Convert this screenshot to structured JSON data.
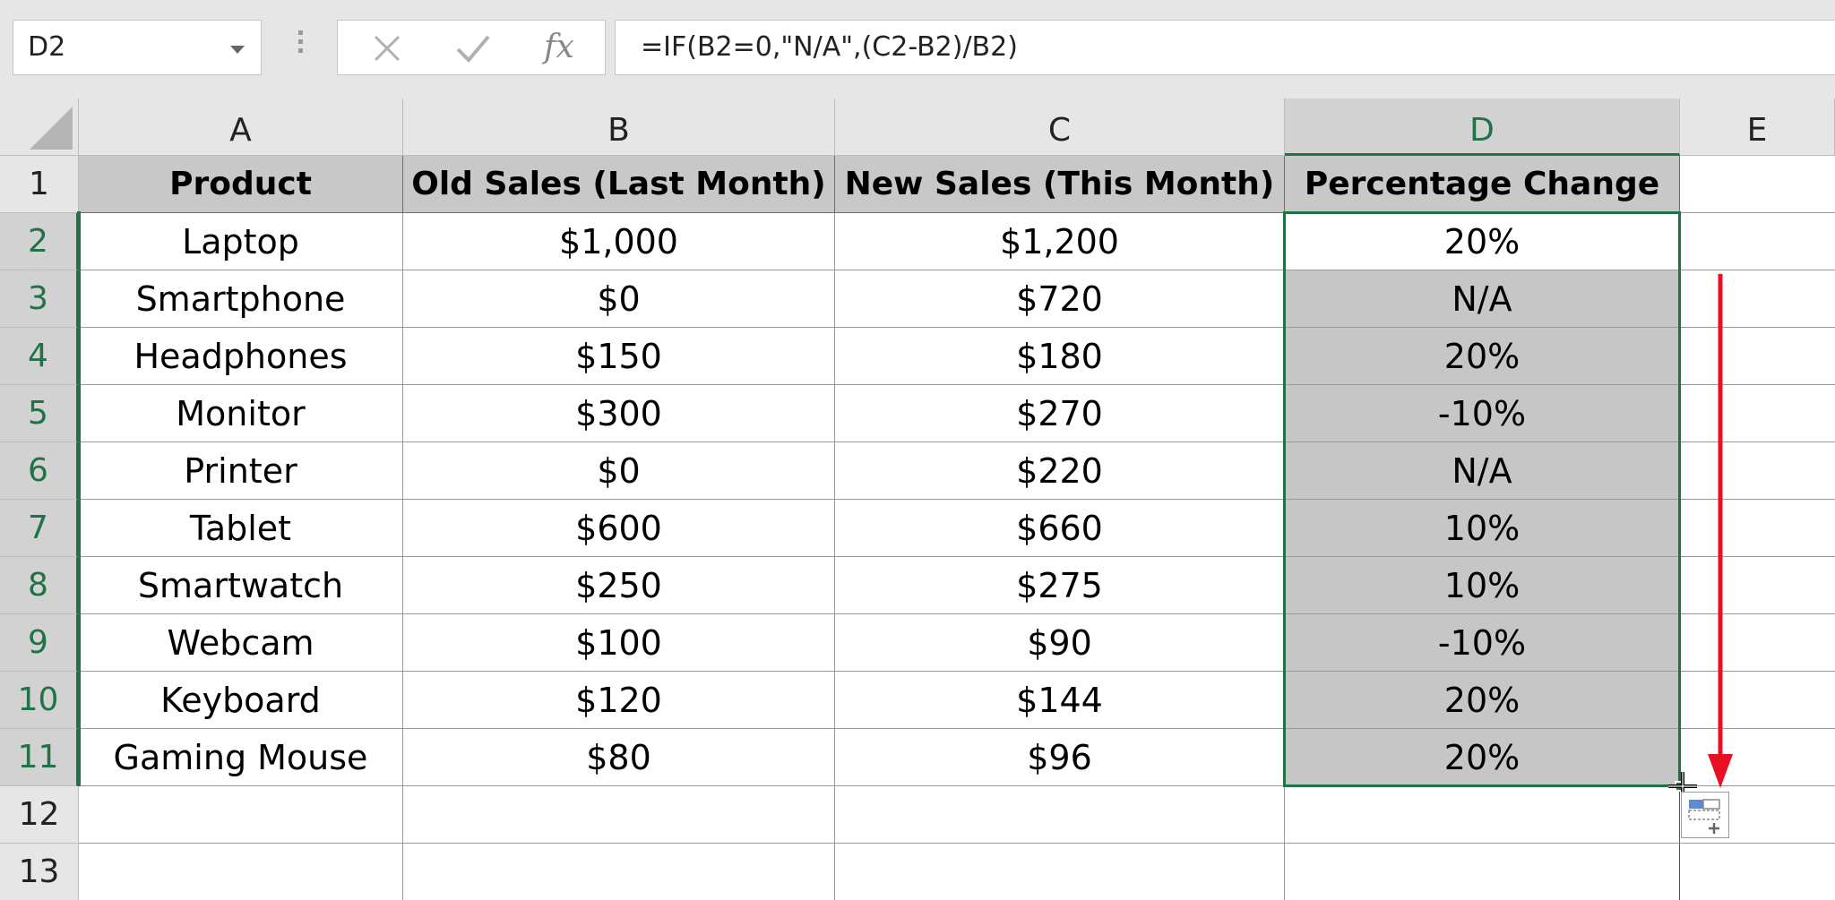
{
  "formula_bar": {
    "name_box": "D2",
    "formula": "=IF(B2=0,\"N/A\",(C2-B2)/B2)"
  },
  "columns": [
    "A",
    "B",
    "C",
    "D",
    "E"
  ],
  "rows": [
    "1",
    "2",
    "3",
    "4",
    "5",
    "6",
    "7",
    "8",
    "9",
    "10",
    "11",
    "12",
    "13"
  ],
  "table": {
    "headers": [
      "Product",
      "Old Sales (Last Month)",
      "New Sales (This Month)",
      "Percentage Change"
    ],
    "data": [
      [
        "Laptop",
        "$1,000",
        "$1,200",
        "20%"
      ],
      [
        "Smartphone",
        "$0",
        "$720",
        "N/A"
      ],
      [
        "Headphones",
        "$150",
        "$180",
        "20%"
      ],
      [
        "Monitor",
        "$300",
        "$270",
        "-10%"
      ],
      [
        "Printer",
        "$0",
        "$220",
        "N/A"
      ],
      [
        "Tablet",
        "$600",
        "$660",
        "10%"
      ],
      [
        "Smartwatch",
        "$250",
        "$275",
        "10%"
      ],
      [
        "Webcam",
        "$100",
        "$90",
        "-10%"
      ],
      [
        "Keyboard",
        "$120",
        "$144",
        "20%"
      ],
      [
        "Gaming Mouse",
        "$80",
        "$96",
        "20%"
      ]
    ]
  },
  "colors": {
    "selection_green": "#217346",
    "header_fill": "#c8c8c8",
    "selected_fill": "#c6c6c6",
    "arrow_red": "#e81123"
  }
}
